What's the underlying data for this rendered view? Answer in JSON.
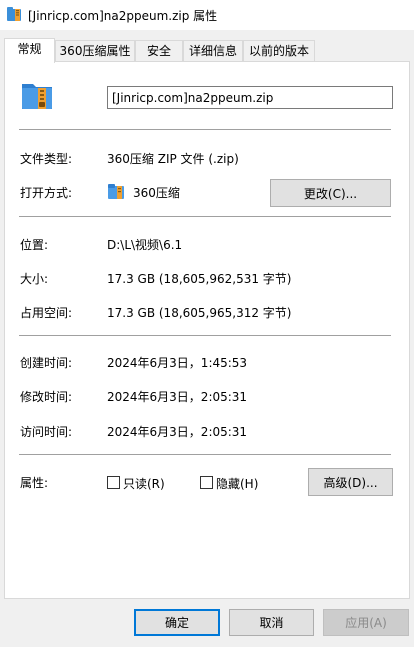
{
  "window": {
    "title": "[Jinricp.com]na2ppeum.zip 属性"
  },
  "tabs": [
    {
      "label": "常规",
      "active": true
    },
    {
      "label": "360压缩属性",
      "active": false
    },
    {
      "label": "安全",
      "active": false
    },
    {
      "label": "详细信息",
      "active": false
    },
    {
      "label": "以前的版本",
      "active": false
    }
  ],
  "general": {
    "file_name": "[Jinricp.com]na2ppeum.zip",
    "file_type_label": "文件类型:",
    "file_type_value": "360压缩 ZIP 文件 (.zip)",
    "open_with_label": "打开方式:",
    "open_with_value": "360压缩",
    "change_button": "更改(C)...",
    "location_label": "位置:",
    "location_value": "D:\\L\\视频\\6.1",
    "size_label": "大小:",
    "size_value": "17.3 GB (18,605,962,531 字节)",
    "disk_size_label": "占用空间:",
    "disk_size_value": "17.3 GB (18,605,965,312 字节)",
    "created_label": "创建时间:",
    "created_value": "2024年6月3日，1:45:53",
    "modified_label": "修改时间:",
    "modified_value": "2024年6月3日，2:05:31",
    "accessed_label": "访问时间:",
    "accessed_value": "2024年6月3日，2:05:31",
    "attributes_label": "属性:",
    "readonly_label": "只读(R)",
    "readonly_checked": false,
    "hidden_label": "隐藏(H)",
    "hidden_checked": false,
    "advanced_button": "高级(D)..."
  },
  "footer": {
    "ok_button": "确定",
    "cancel_button": "取消",
    "apply_button": "应用(A)",
    "apply_enabled": false
  },
  "icons": {
    "window_icon": "zip-archive-icon",
    "file_icon": "zip-archive-icon",
    "app_icon": "360zip-app-icon"
  },
  "colors": {
    "accent": "#0078d7",
    "zip_blue": "#3b8fd9",
    "zip_orange": "#f0a030"
  }
}
